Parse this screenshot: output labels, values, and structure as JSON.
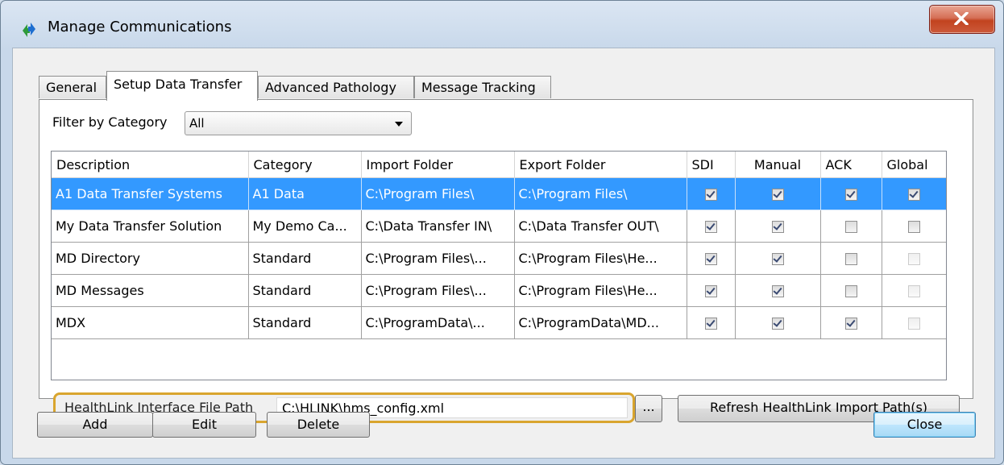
{
  "window": {
    "title": "Manage Communications"
  },
  "tabs": [
    {
      "label": "General",
      "active": false
    },
    {
      "label": "Setup Data Transfer",
      "active": true
    },
    {
      "label": "Advanced Pathology",
      "active": false
    },
    {
      "label": "Message Tracking",
      "active": false
    }
  ],
  "filter": {
    "label": "Filter by Category",
    "value": "All"
  },
  "table": {
    "columns": [
      "Description",
      "Category",
      "Import Folder",
      "Export Folder",
      "SDI",
      "Manual",
      "ACK",
      "Global"
    ],
    "rows": [
      {
        "description": "A1 Data Transfer Systems",
        "category": "A1 Data",
        "import": "C:\\Program Files\\",
        "export": "C:\\Program Files\\",
        "sdi": true,
        "manual": true,
        "ack": true,
        "global": true
      },
      {
        "description": "My Data Transfer Solution",
        "category": "My Demo Ca...",
        "import": "C:\\Data Transfer IN\\",
        "export": "C:\\Data Transfer OUT\\",
        "sdi": true,
        "manual": true,
        "ack": false,
        "global": false
      },
      {
        "description": "MD Directory",
        "category": "Standard",
        "import": "C:\\Program Files\\...",
        "export": "C:\\Program Files\\He...",
        "sdi": true,
        "manual": true,
        "ack": false,
        "global": false
      },
      {
        "description": "MD Messages",
        "category": "Standard",
        "import": "C:\\Program Files\\...",
        "export": "C:\\Program Files\\He...",
        "sdi": true,
        "manual": true,
        "ack": false,
        "global": false
      },
      {
        "description": "MDX",
        "category": "Standard",
        "import": "C:\\ProgramData\\...",
        "export": "C:\\ProgramData\\MD...",
        "sdi": true,
        "manual": true,
        "ack": true,
        "global": false
      }
    ]
  },
  "healthlink": {
    "label": "HealthLink Interface File Path",
    "value": "C:\\HLINK\\hms_config.xml"
  },
  "buttons": {
    "browse": "...",
    "refresh": "Refresh HealthLink Import Path(s)",
    "add": "Add",
    "edit": "Edit",
    "delete": "Delete",
    "close": "Close"
  },
  "colors": {
    "selection": "#3399ff",
    "highlight_border": "#d9a52e"
  }
}
